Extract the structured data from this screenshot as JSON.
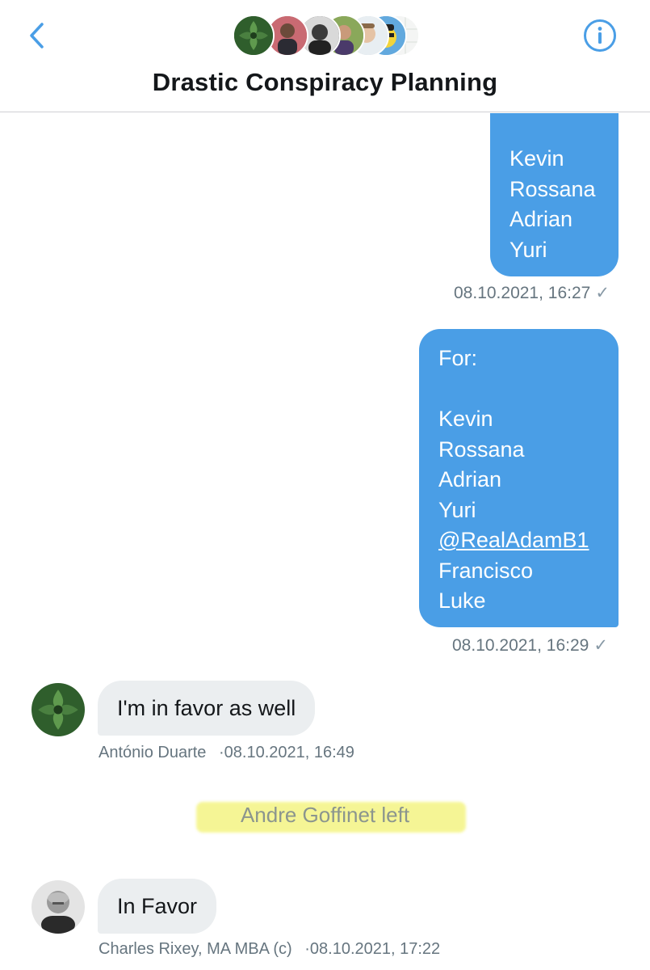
{
  "header": {
    "title": "Drastic Conspiracy Planning",
    "back_icon": "chevron-left-icon",
    "info_icon": "info-icon",
    "accent_color": "#4a9ee6"
  },
  "messages": [
    {
      "type": "outgoing",
      "lines": [
        "Kevin",
        "Rossana",
        "Adrian",
        "Yuri"
      ],
      "timestamp": "08.10.2021, 16:27",
      "status_icon": "checkmark-icon"
    },
    {
      "type": "outgoing",
      "lines": [
        "For:",
        "",
        "Kevin",
        "Rossana",
        "Adrian",
        "Yuri",
        "@RealAdamB1",
        "Francisco",
        "Luke"
      ],
      "timestamp": "08.10.2021, 16:29",
      "status_icon": "checkmark-icon"
    },
    {
      "type": "incoming",
      "text": "I'm in favor as well",
      "sender": "António Duarte",
      "timestamp": "08.10.2021, 16:49"
    },
    {
      "type": "system",
      "text": "Andre Goffinet left"
    },
    {
      "type": "incoming",
      "text": "In Favor",
      "sender": "Charles Rixey, MA MBA (c)",
      "timestamp": "08.10.2021, 17:22"
    }
  ],
  "separator": "·",
  "colors": {
    "outgoing_bubble": "#4a9ee6",
    "incoming_bubble": "#ebeef0",
    "timestamp": "#66757f",
    "highlight": "#f5f58a"
  }
}
